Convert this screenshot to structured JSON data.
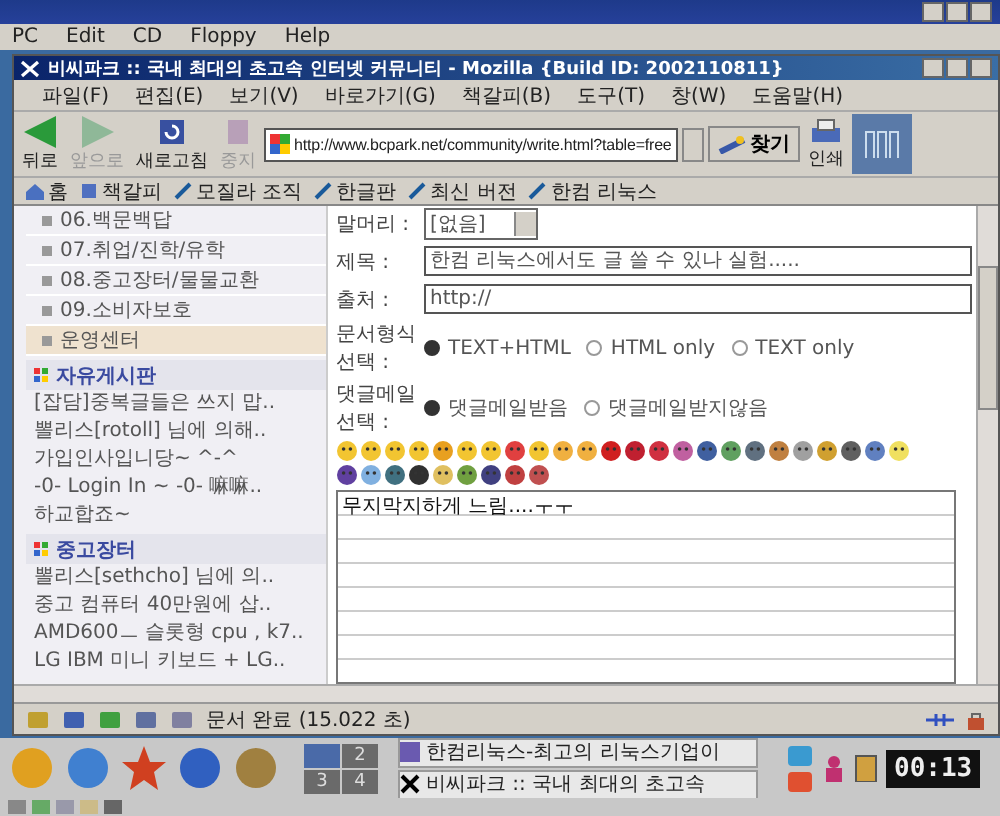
{
  "desktop_window": {
    "menu": [
      "PC",
      "Edit",
      "CD",
      "Floppy",
      "Help"
    ]
  },
  "browser": {
    "title": "비씨파크 :: 국내 최대의 초고속 인터넷 커뮤니티 - Mozilla {Build ID: 2002110811}",
    "menu": [
      "파일(F)",
      "편집(E)",
      "보기(V)",
      "바로가기(G)",
      "책갈피(B)",
      "도구(T)",
      "창(W)",
      "도움말(H)"
    ],
    "nav_buttons": [
      {
        "kind": "back",
        "label": "뒤로",
        "disabled": false
      },
      {
        "kind": "forward",
        "label": "앞으로",
        "disabled": true
      },
      {
        "kind": "reload",
        "label": "새로고침",
        "disabled": false
      },
      {
        "kind": "stop",
        "label": "중지",
        "disabled": true
      }
    ],
    "url": "http://www.bcpark.net/community/write.html?table=free",
    "search_button": "찾기",
    "print_button": "인쇄",
    "bookmarks": [
      "홈",
      "책갈피",
      "모질라 조직",
      "한글판",
      "최신 버전",
      "한컴 리눅스"
    ]
  },
  "sidebar": {
    "items": [
      {
        "label": "06.백문백답",
        "selected": false
      },
      {
        "label": "07.취업/진학/유학",
        "selected": false
      },
      {
        "label": "08.중고장터/물물교환",
        "selected": false
      },
      {
        "label": "09.소비자보호",
        "selected": false
      },
      {
        "label": "운영센터",
        "selected": true
      }
    ],
    "sections": [
      {
        "title": "자유게시판",
        "posts": [
          "[잡담]중복글들은 쓰지 맙..",
          "뽈리스[rotoll] 님에 의해..",
          "가입인사입니당~ ^-^",
          "-0- Login In ~ -0- 嘛嘛..",
          "하교합죠~"
        ]
      },
      {
        "title": "중고장터",
        "posts": [
          "뽈리스[sethcho] 님에 의..",
          "중고 컴퓨터 40만원에 삽..",
          "AMD600ㅡ 슬롯형 cpu , k7..",
          "LG IBM 미니 키보드 + LG.."
        ]
      }
    ]
  },
  "form": {
    "fields": [
      {
        "kind": "select",
        "label": "말머리 :",
        "value": "[없음]"
      },
      {
        "kind": "text",
        "label": "제목 :",
        "value": "한컴 리눅스에서도 글 쓸 수 있나 실험....."
      },
      {
        "kind": "text",
        "label": "출처 :",
        "value": "http://"
      },
      {
        "kind": "radio",
        "label": "문서형식 선택 :",
        "options": [
          {
            "label": "TEXT+HTML",
            "selected": true
          },
          {
            "label": "HTML only",
            "selected": false
          },
          {
            "label": "TEXT only",
            "selected": false
          }
        ]
      },
      {
        "kind": "radio",
        "label": "댓글메일 선택 :",
        "options": [
          {
            "label": "댓글메일받음",
            "selected": true
          },
          {
            "label": "댓글메일받지않음",
            "selected": false
          }
        ]
      }
    ],
    "body": "무지막지하게 느림....ㅜㅜ"
  },
  "status_bar": {
    "text": "문서 완료 (15.022 초)"
  },
  "taskbar": {
    "pager": [
      {
        "selected": true
      },
      {
        "label": "2",
        "selected": false
      },
      {
        "label": "3",
        "selected": false
      },
      {
        "label": "4",
        "selected": false
      }
    ],
    "tasks": [
      "한컴리눅스-최고의 리눅스기업이",
      "비씨파크 :: 국내 최대의 초고속"
    ],
    "clock": "00:13"
  }
}
